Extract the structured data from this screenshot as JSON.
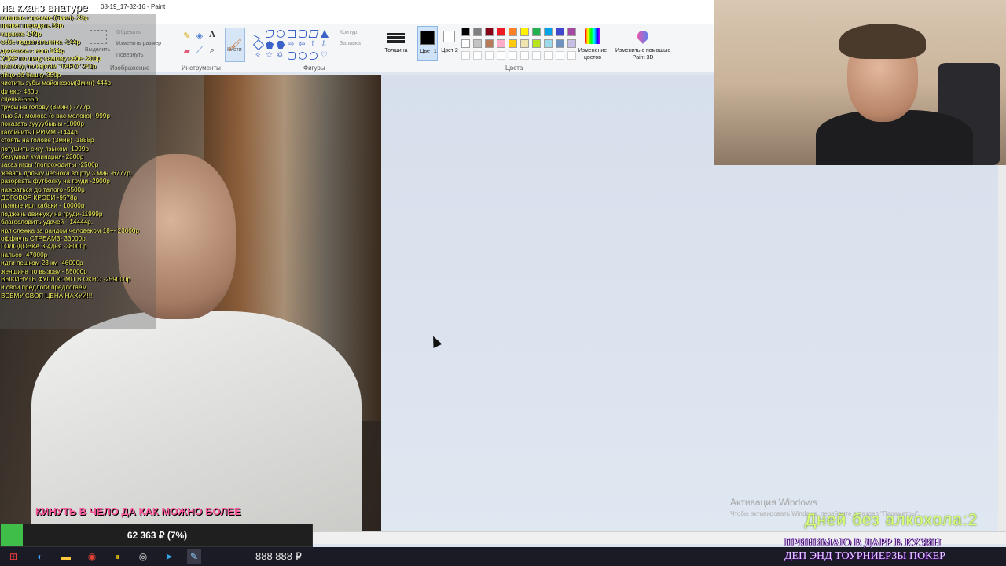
{
  "window": {
    "title": "08-19_17-32-16 - Paint"
  },
  "ribbon": {
    "image_group": {
      "label": "Изображение",
      "crop": "Обрезать",
      "resize": "Изменить размер",
      "rotate": "Повернуть",
      "select": "Выделить"
    },
    "tools_group": {
      "label": "Инструменты",
      "brushes": "Кисти"
    },
    "shapes_group": {
      "label": "Фигуры",
      "outline": "Контур",
      "fill": "Заливка"
    },
    "thickness": "Толщина",
    "color1": "Цвет 1",
    "color2": "Цвет 2",
    "colors_group": {
      "label": "Цвета"
    },
    "edit_colors": "Изменение цветов",
    "paint3d": "Изменить с помощью Paint 3D",
    "palette_row1": [
      "#000000",
      "#7f7f7f",
      "#880015",
      "#ed1c24",
      "#ff7f27",
      "#fff200",
      "#22b14c",
      "#00a2e8",
      "#3f48cc",
      "#a349a4"
    ],
    "palette_row2": [
      "#ffffff",
      "#c3c3c3",
      "#b97a57",
      "#ffaec9",
      "#ffc90e",
      "#efe4b0",
      "#b5e61d",
      "#99d9ea",
      "#7092be",
      "#c8bfe7"
    ]
  },
  "overlay": {
    "stream_title": "на кханз внатуре",
    "price_list": [
      "клипина стреаме (5мин)- 29р",
      "привет передать 89р",
      "караоке-149р",
      "себе подзатыльника -144р",
      "двоечкаа с ноги 144р",
      "УДАР по лицу самому себе -200р",
      "расклад по картам \"ТАРО\" 241р",
      "яйцо об башку-350р",
      "чистить зубы майонезом(3мин)-444р",
      "флекс- 450р",
      "сценка-555р",
      "трусы на голову (8мин ) -777р",
      "пью 3л. молока (с вас молоко) -999р",
      "показать зуууубыыы -1000р",
      "какойнить ГРИММ -1444р",
      "стоять на голове (3мин) -1888р",
      "потушить сигу языком -1999р",
      "безумная кулинария- 2300р",
      "заказ игры (попроходить) -2500р",
      "жевать дольку чеснока во рту 3 мин -6777р.",
      "разорвать футболку на груди -2900р",
      "нажраться до талого -5500р",
      "ДОГОВОР КРОВИ -9578р",
      "пьяные ирл кабаки - 10000р",
      "поджечь движуху на груди-11999р",
      "благословить удачей - 14444р.",
      "ирл слежка за рандом человеком 18+- 23000р",
      "оффнуть СТРЕАМ3- 33000р.",
      "ГОЛОДОВКА 3-4дня -38000р",
      "нальсо -47000р",
      "идти пешком 23 км -46000р",
      "женщина по вызову - 55000р",
      "ВЫКИНУТЬ ФУЛЛ КОМП В ОКНО -259000р",
      "и свои предлоги предлогаем",
      "ВСЕМУ СВОЯ ЦЕНА НАХУЙ!!!"
    ],
    "goal_text": "КИНУТЬ В ЧЕЛО ДА КАК МОЖНО БОЛЕЕ",
    "goal_amount": "62 363 ₽ (7%)",
    "goal_progress": 0.07,
    "days_counter": "Дней без алкохола:2",
    "promo_lines": [
      "ПРИНИМАЮ В ДАРР В КУЗИН",
      "ДЕП ЭНД ТОУРНИЕРЗЫ ПОКЕР"
    ]
  },
  "activation": {
    "title": "Активация Windows",
    "subtitle": "Чтобы активировать Windows, перейдите в раздел \"Параметры\"."
  },
  "taskbar": {
    "money": "888 888 ₽",
    "icons": [
      "windows-start",
      "edge",
      "file-explorer",
      "chrome",
      "stream-app",
      "obs",
      "telegram",
      "paint"
    ]
  }
}
